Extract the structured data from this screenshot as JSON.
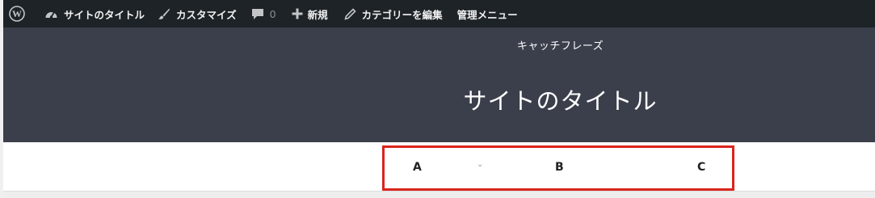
{
  "admin_bar": {
    "site_name": "サイトのタイトル",
    "customize": "カスタマイズ",
    "comments_count": "0",
    "new": "新規",
    "edit_category": "カテゴリーを編集",
    "admin_menu": "管理メニュー"
  },
  "header": {
    "tagline": "キャッチフレーズ",
    "title": "サイトのタイトル"
  },
  "nav": {
    "items": [
      "A",
      "B",
      "C"
    ]
  },
  "colors": {
    "admin_bar_bg": "#1d2327",
    "header_bg": "#3b3f4c",
    "highlight": "#d9251d"
  }
}
